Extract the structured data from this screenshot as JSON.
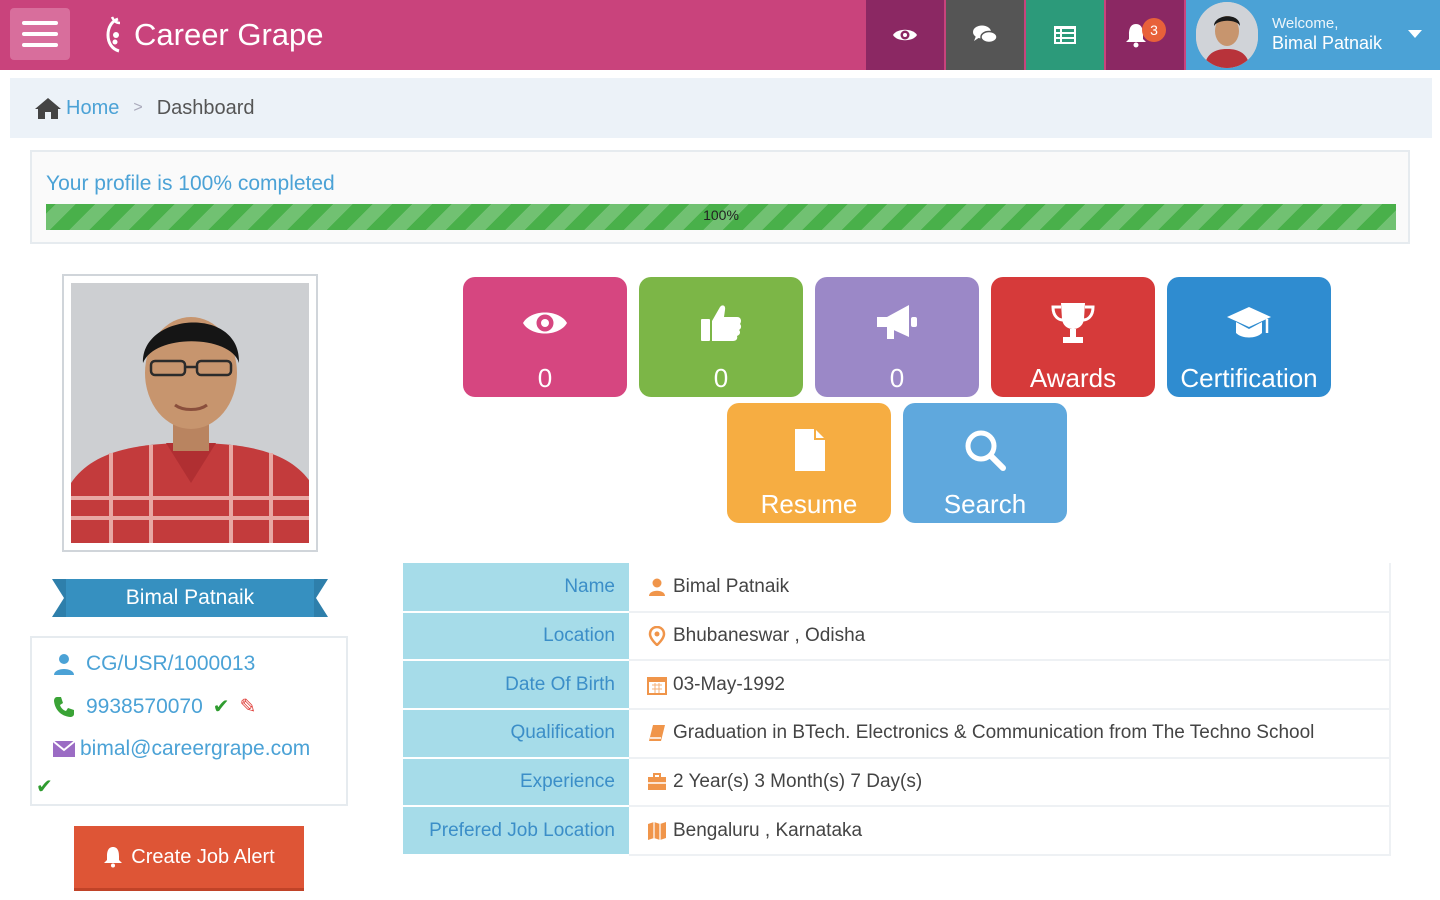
{
  "navbar": {
    "brand": "Career Grape",
    "notification_count": "3",
    "user": {
      "welcome": "Welcome,",
      "name": "Bimal Patnaik"
    },
    "colors": {
      "bar": "#c9437c",
      "views": "#8b2863",
      "chat": "#555555",
      "menu": "#2c9a7a",
      "notify": "#8b2863",
      "user": "#4ba2d6"
    }
  },
  "breadcrumb": {
    "home": "Home",
    "current": "Dashboard"
  },
  "profile_progress": {
    "text": "Your profile is 100% completed",
    "label": "100%",
    "percent": 100
  },
  "profile": {
    "name": "Bimal Patnaik",
    "user_id": "CG/USR/1000013",
    "phone": "9938570070",
    "email": "bimal@careergrape.com"
  },
  "create_alert_label": "Create Job Alert",
  "tiles": [
    {
      "label": "0",
      "icon": "eye-icon",
      "color": "#d64680"
    },
    {
      "label": "0",
      "icon": "thumbs-up-icon",
      "color": "#7cb647"
    },
    {
      "label": "0",
      "icon": "megaphone-icon",
      "color": "#9b88c7"
    },
    {
      "label": "Awards",
      "icon": "trophy-icon",
      "color": "#d63a3a"
    },
    {
      "label": "Certification",
      "icon": "graduation-cap-icon",
      "color": "#2f8cd0"
    },
    {
      "label": "Resume",
      "icon": "file-icon",
      "color": "#f6ad42"
    },
    {
      "label": "Search",
      "icon": "search-icon",
      "color": "#5fa8dd"
    }
  ],
  "details": [
    {
      "label": "Name",
      "value": "Bimal Patnaik",
      "icon": "user-icon"
    },
    {
      "label": "Location",
      "value": "Bhubaneswar , Odisha",
      "icon": "map-marker-icon"
    },
    {
      "label": "Date Of Birth",
      "value": "03-May-1992",
      "icon": "calendar-icon"
    },
    {
      "label": "Qualification",
      "value": "Graduation in BTech. Electronics & Communication from The Techno School",
      "icon": "book-icon"
    },
    {
      "label": "Experience",
      "value": "2 Year(s) 3 Month(s) 7 Day(s)",
      "icon": "briefcase-icon"
    },
    {
      "label": "Prefered Job Location",
      "value": "Bengaluru , Karnataka",
      "icon": "map-icon"
    }
  ]
}
